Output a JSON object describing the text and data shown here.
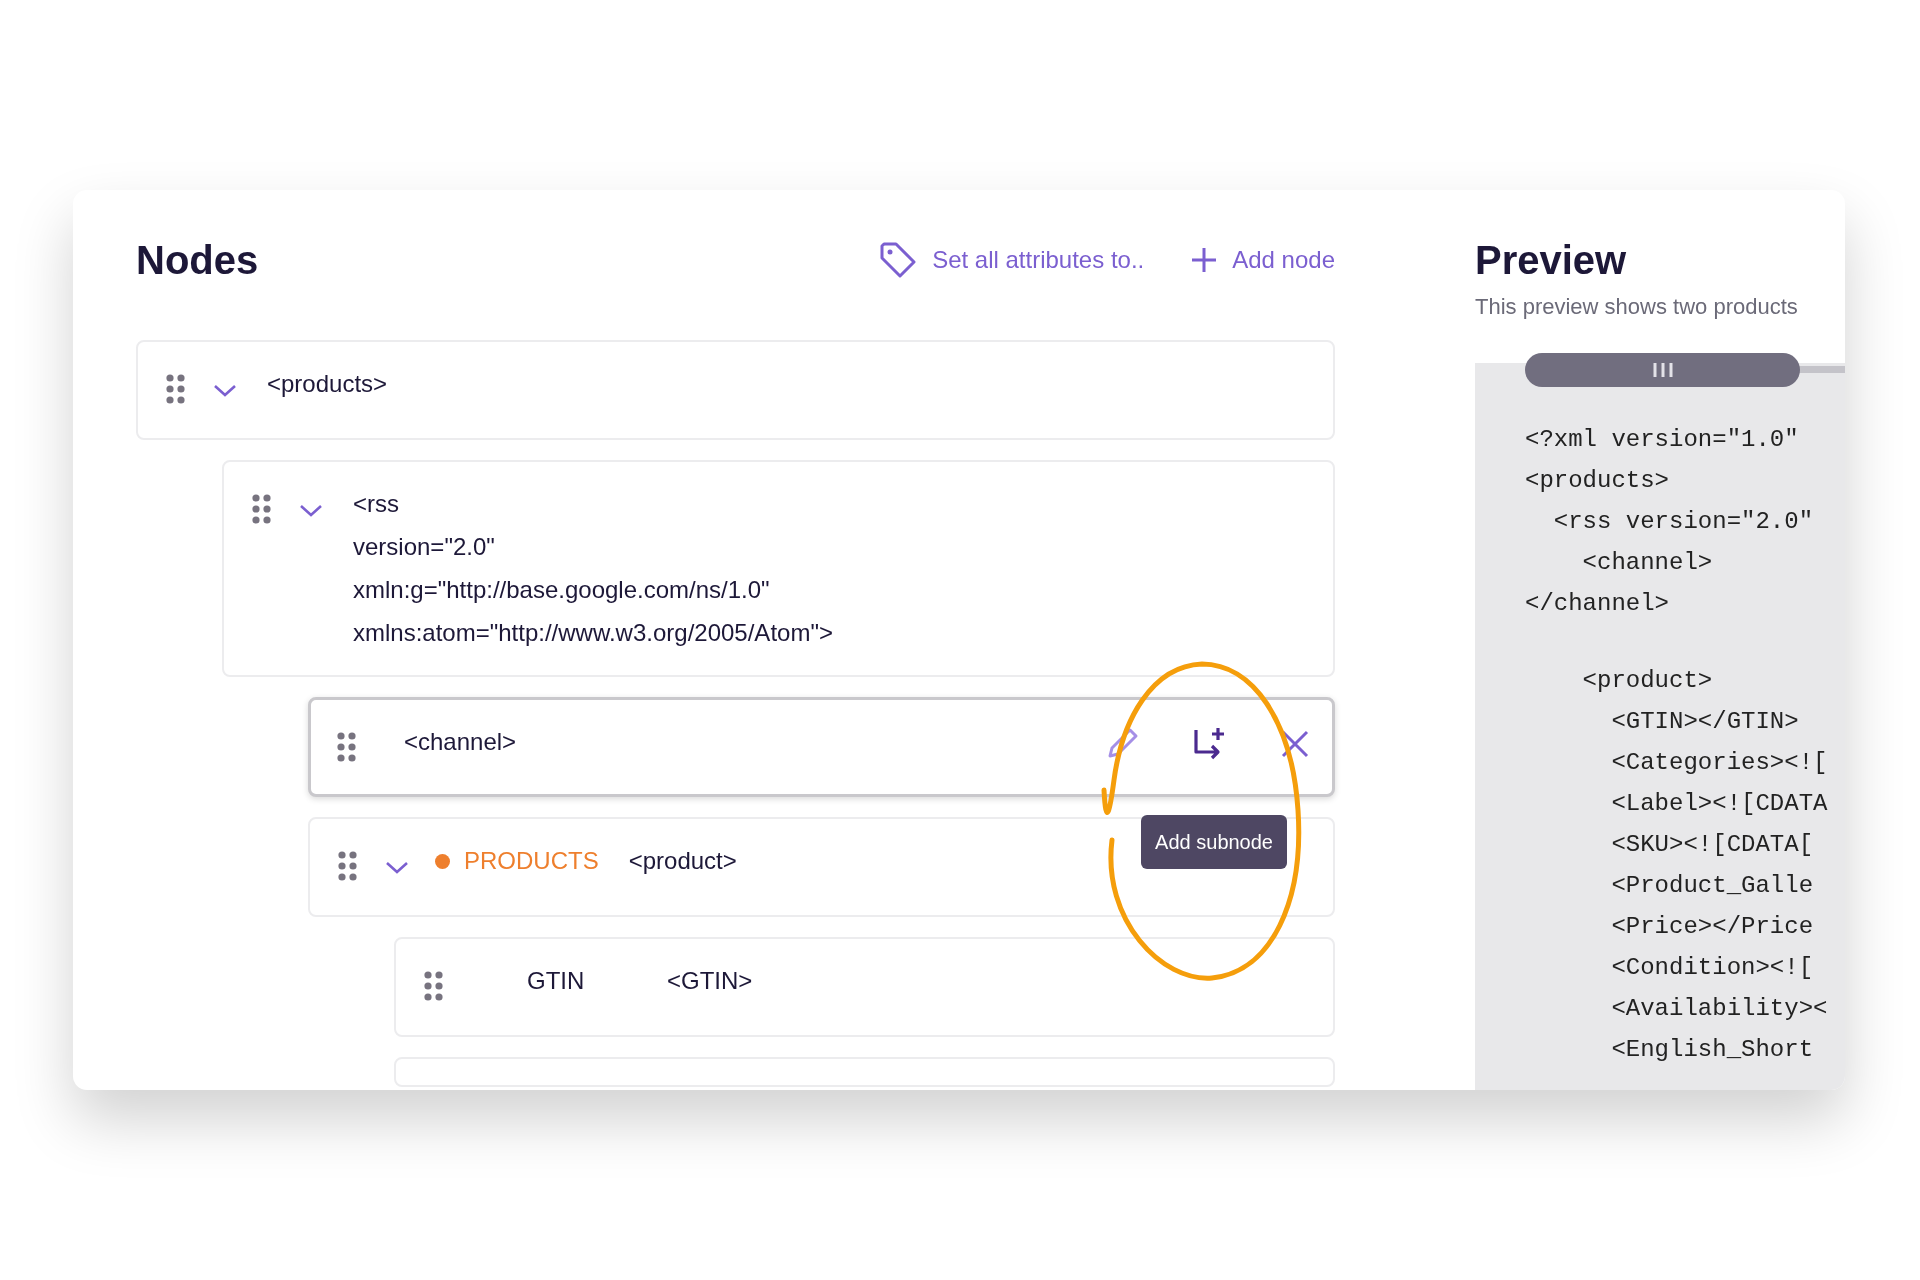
{
  "nodes_panel": {
    "title": "Nodes",
    "actions": [
      {
        "kind": "tag",
        "label": "Set all attributes to.."
      },
      {
        "kind": "plus",
        "label": "Add node"
      }
    ],
    "tree": [
      {
        "tag_lines": [
          "<products>"
        ],
        "expanded": true,
        "hovered": false,
        "children": [
          {
            "tag_lines": [
              "<rss",
              "version=\"2.0\"",
              "xmln:g=\"http://base.google.com/ns/1.0\"",
              "xmlns:atom=\"http://www.w3.org/2005/Atom\">"
            ],
            "expanded": true,
            "hovered": false,
            "children": [
              {
                "tag_lines": [
                  "<channel>"
                ],
                "hovered": true,
                "tooltip": "Add subnode"
              },
              {
                "mapping": {
                  "text": "PRODUCTS",
                  "color": "#ee7f2d"
                },
                "tag_lines": [
                  "<product>"
                ],
                "expanded": true,
                "hovered": false,
                "children": [
                  {
                    "mapping": {
                      "text": "GTIN"
                    },
                    "tag_lines": [
                      "<GTIN>"
                    ],
                    "hovered": false
                  },
                  {
                    "hovered": false
                  }
                ]
              }
            ]
          }
        ]
      }
    ]
  },
  "preview_panel": {
    "title": "Preview",
    "subtitle": "This preview shows two products",
    "code_lines": [
      {
        "text": "<?xml version=\"1.0\""
      },
      {
        "text": "<products>"
      },
      {
        "text": "  <rss version=\"2.0\""
      },
      {
        "text": "    <channel>"
      },
      {
        "text": "</channel>"
      },
      {
        "text": "    <product>",
        "blank_before": true
      },
      {
        "text": "      <GTIN></GTIN>"
      },
      {
        "text": "      <Categories><!["
      },
      {
        "text": "      <Label><![CDATA"
      },
      {
        "text": "      <SKU><![CDATA["
      },
      {
        "text": "      <Product_Galle"
      },
      {
        "text": "      <Price></Price"
      },
      {
        "text": "      <Condition><!["
      },
      {
        "text": "      <Availability><"
      },
      {
        "text": "      <English_Short"
      }
    ]
  }
}
